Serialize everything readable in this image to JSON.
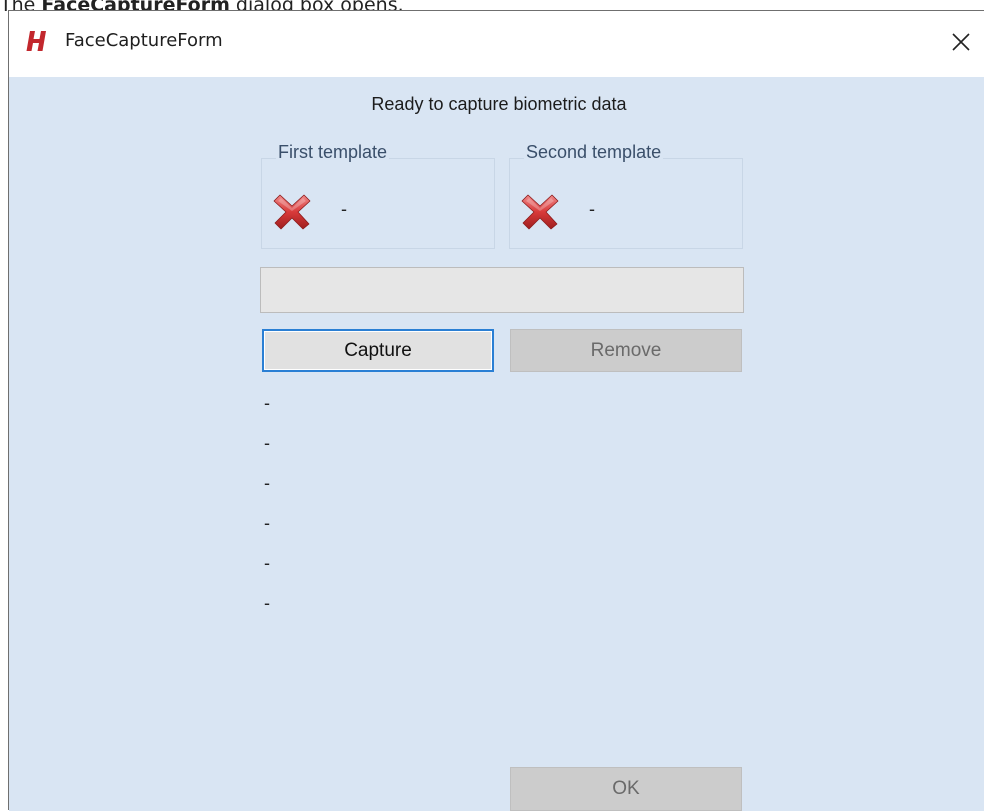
{
  "caption": {
    "prefix": "The ",
    "bold": "FaceCaptureForm",
    "suffix": " dialog box opens."
  },
  "window": {
    "title": "FaceCaptureForm",
    "logo_letter": "H",
    "close_glyph": "✕"
  },
  "status": "Ready to capture biometric data",
  "templates": [
    {
      "title": "First template",
      "value": "-",
      "icon": "x-icon"
    },
    {
      "title": "Second template",
      "value": "-",
      "icon": "x-icon"
    }
  ],
  "buttons": {
    "capture": "Capture",
    "remove": "Remove",
    "ok": "OK"
  },
  "info_lines": [
    "-",
    "-",
    "-",
    "-",
    "-",
    "-"
  ],
  "colors": {
    "logo": "#c2272d",
    "client_bg": "#d9e5f3",
    "focus_border": "#2a7fd4"
  }
}
